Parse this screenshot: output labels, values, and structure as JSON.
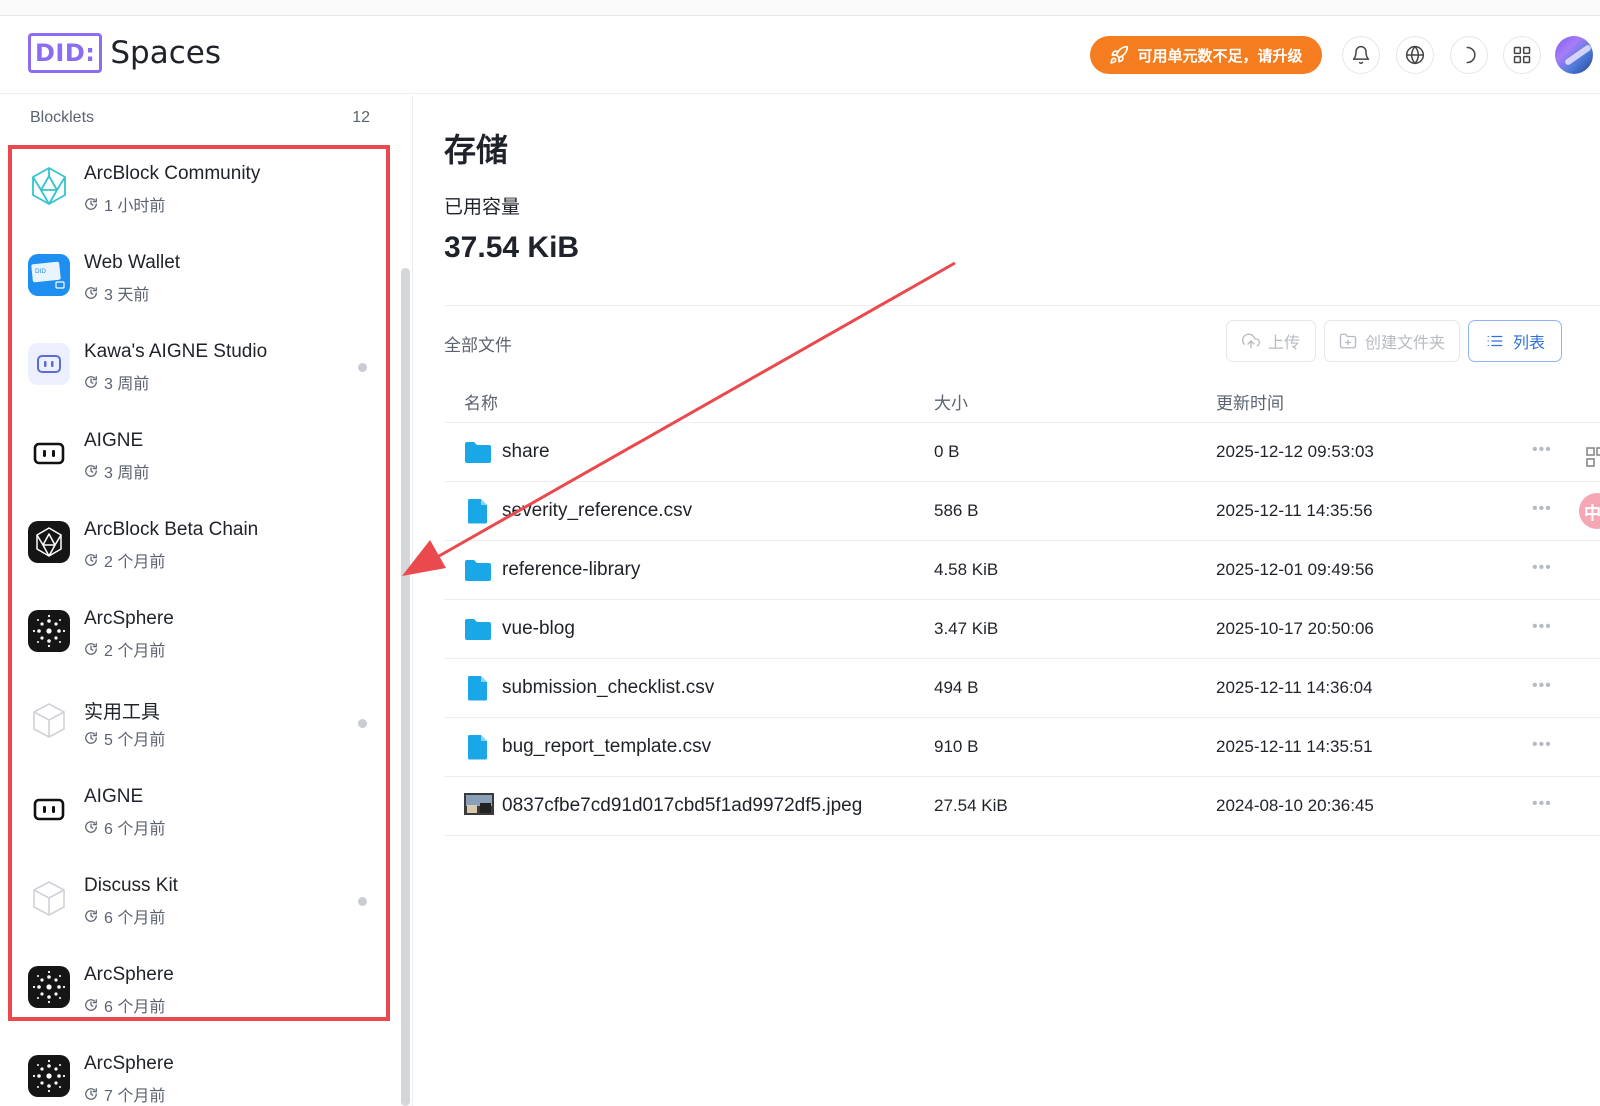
{
  "header": {
    "logo_did": "DID:",
    "logo_spaces": "Spaces",
    "upgrade_label": "可用单元数不足，请升级"
  },
  "sidebar": {
    "title": "Blocklets",
    "count": "12",
    "items": [
      {
        "name": "ArcBlock Community",
        "time": "1 小时前",
        "icon": "arcblock-community-icon",
        "dot": false
      },
      {
        "name": "Web Wallet",
        "time": "3 天前",
        "icon": "web-wallet-icon",
        "dot": false
      },
      {
        "name": "Kawa's AIGNE Studio",
        "time": "3 周前",
        "icon": "aigne-studio-icon",
        "dot": true
      },
      {
        "name": "AIGNE",
        "time": "3 周前",
        "icon": "aigne-icon",
        "dot": false
      },
      {
        "name": "ArcBlock Beta Chain",
        "time": "2 个月前",
        "icon": "beta-chain-icon",
        "dot": false
      },
      {
        "name": "ArcSphere",
        "time": "2 个月前",
        "icon": "arcsphere-icon",
        "dot": false
      },
      {
        "name": "实用工具",
        "time": "5 个月前",
        "icon": "cube-icon",
        "dot": true
      },
      {
        "name": "AIGNE",
        "time": "6 个月前",
        "icon": "aigne-icon",
        "dot": false
      },
      {
        "name": "Discuss Kit",
        "time": "6 个月前",
        "icon": "cube-icon",
        "dot": true
      },
      {
        "name": "ArcSphere",
        "time": "6 个月前",
        "icon": "arcsphere-icon",
        "dot": false
      },
      {
        "name": "ArcSphere",
        "time": "7 个月前",
        "icon": "arcsphere-icon",
        "dot": false
      }
    ]
  },
  "main": {
    "title": "存储",
    "used_label": "已用容量",
    "used_value": "37.54 KiB",
    "files_label": "全部文件",
    "toolbar": {
      "upload": "上传",
      "new_folder": "创建文件夹",
      "list": "列表"
    },
    "columns": {
      "name": "名称",
      "size": "大小",
      "updated": "更新时间"
    },
    "files": [
      {
        "name": "share",
        "size": "0 B",
        "date": "2025-12-12 09:53:03",
        "type": "folder"
      },
      {
        "name": "severity_reference.csv",
        "size": "586 B",
        "date": "2025-12-11 14:35:56",
        "type": "file"
      },
      {
        "name": "reference-library",
        "size": "4.58 KiB",
        "date": "2025-12-01 09:49:56",
        "type": "folder"
      },
      {
        "name": "vue-blog",
        "size": "3.47 KiB",
        "date": "2025-10-17 20:50:06",
        "type": "folder"
      },
      {
        "name": "submission_checklist.csv",
        "size": "494 B",
        "date": "2025-12-11 14:36:04",
        "type": "file"
      },
      {
        "name": "bug_report_template.csv",
        "size": "910 B",
        "date": "2025-12-11 14:35:51",
        "type": "file"
      },
      {
        "name": "0837cfbe7cd91d017cbd5f1ad9972df5.jpeg",
        "size": "27.54 KiB",
        "date": "2024-08-10 20:36:45",
        "type": "image"
      }
    ],
    "more_glyph": "•••"
  },
  "edge": {
    "pink_glyph": "中"
  },
  "colors": {
    "accent_orange": "#f57c1f",
    "brand_purple": "#8b6cf3",
    "folder_blue": "#1aa7e8",
    "annotation_red": "#ea4a4d",
    "list_blue": "#2f6fe0"
  }
}
